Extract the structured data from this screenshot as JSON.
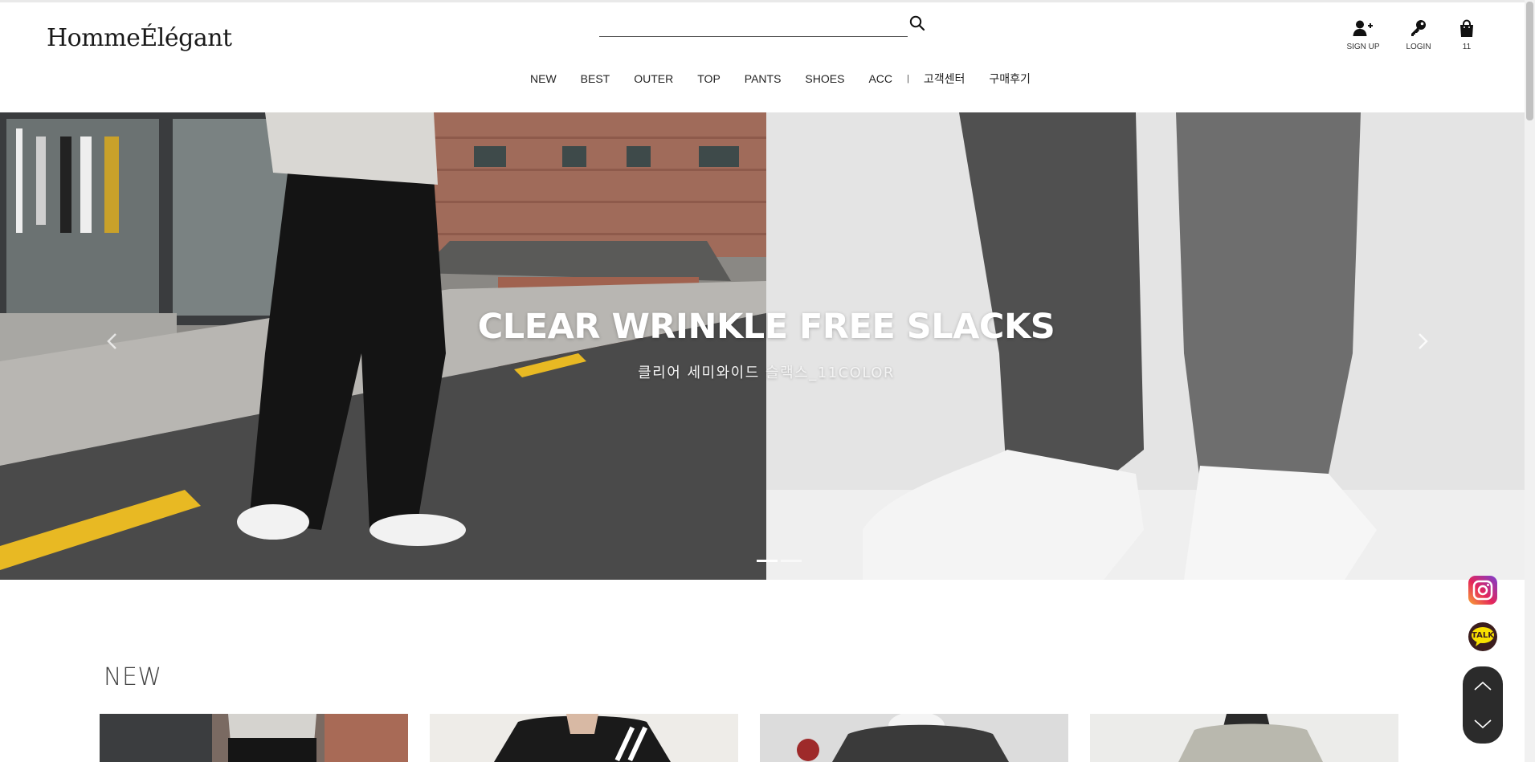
{
  "brand": {
    "logo_text": "HommeÉlégant"
  },
  "search": {
    "placeholder": "",
    "value": "",
    "icon": "search-icon"
  },
  "utility": {
    "signup": {
      "label": "SIGN UP",
      "icon": "user-plus-icon"
    },
    "login": {
      "label": "LOGIN",
      "icon": "key-icon"
    },
    "cart": {
      "label": "11",
      "icon": "shopping-bag-icon"
    }
  },
  "nav": {
    "items": [
      "NEW",
      "BEST",
      "OUTER",
      "TOP",
      "PANTS",
      "SHOES",
      "ACC"
    ],
    "separator": "|",
    "extra": [
      "고객센터",
      "구매후기"
    ]
  },
  "banner": {
    "title": "CLEAR WRINKLE FREE SLACKS",
    "subtitle": "클리어 세미와이드 슬랙스_11COLOR",
    "prev_icon": "chevron-left-icon",
    "next_icon": "chevron-right-icon",
    "slides_count": 2,
    "active_slide": 1
  },
  "section": {
    "title": "NEW"
  },
  "floating": {
    "instagram_icon": "instagram-icon",
    "talk": {
      "label": "TALK",
      "icon": "kakao-talk-icon"
    },
    "scroll_up_icon": "chevron-up-icon",
    "scroll_down_icon": "chevron-down-icon"
  },
  "colors": {
    "text": "#222222",
    "talk_yellow": "#f9e000",
    "talk_brown": "#3c1e1e",
    "scroll_box": "#2b2b2b",
    "road_yellow": "#e8b923"
  }
}
